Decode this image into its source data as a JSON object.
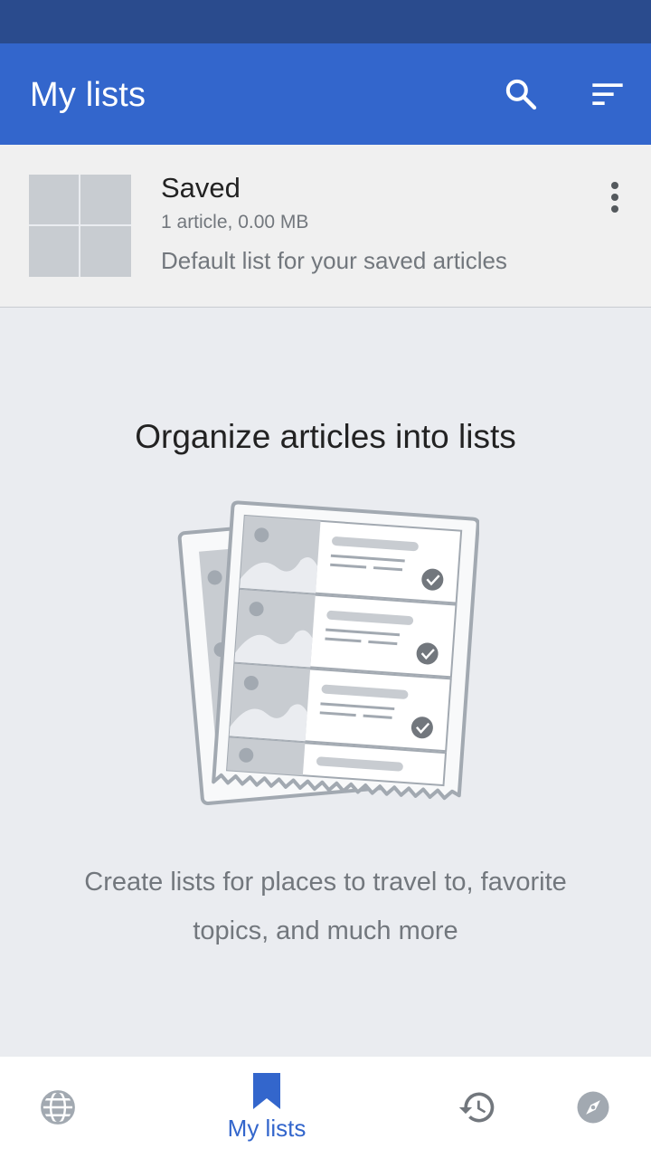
{
  "app_bar": {
    "title": "My lists",
    "search_icon": "search-icon",
    "sort_icon": "sort-icon"
  },
  "saved_list": {
    "title": "Saved",
    "meta": "1 article, 0.00 MB",
    "description": "Default list for your saved articles",
    "menu_icon": "overflow-menu-icon"
  },
  "empty_state": {
    "title": "Organize articles into lists",
    "description": "Create lists for places to travel to, favorite topics, and much more"
  },
  "bottom_nav": {
    "items": [
      {
        "icon": "globe-icon",
        "label": ""
      },
      {
        "icon": "bookmark-icon",
        "label": "My lists",
        "active": true
      },
      {
        "icon": "history-icon",
        "label": ""
      },
      {
        "icon": "compass-icon",
        "label": ""
      }
    ]
  },
  "colors": {
    "status_bar": "#2a4b8d",
    "app_bar": "#3366cc",
    "accent": "#3366cc",
    "background": "#eaecf0"
  }
}
